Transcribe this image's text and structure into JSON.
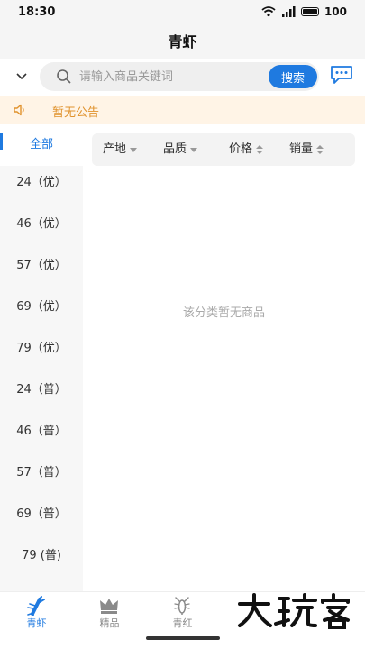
{
  "status": {
    "time": "18:30",
    "battery": "100"
  },
  "header": {
    "title": "青虾"
  },
  "search": {
    "placeholder": "请输入商品关键词",
    "button_label": "搜索"
  },
  "notice": {
    "text": "暂无公告"
  },
  "sidebar": {
    "items": [
      {
        "label": "全部",
        "active": true
      },
      {
        "label": "24（优）"
      },
      {
        "label": "46（优）"
      },
      {
        "label": "57（优）"
      },
      {
        "label": "69（优）"
      },
      {
        "label": "79（优）"
      },
      {
        "label": "24（普）"
      },
      {
        "label": "46（普）"
      },
      {
        "label": "57（普）"
      },
      {
        "label": "69（普）"
      },
      {
        "label": "79 (普)"
      }
    ]
  },
  "sort": {
    "items": [
      "产地",
      "品质",
      "价格",
      "销量"
    ]
  },
  "empty": {
    "text": "该分类暂无商品"
  },
  "tabbar": {
    "items": [
      {
        "label": "青虾",
        "icon": "lobster-icon",
        "active": true
      },
      {
        "label": "精品",
        "icon": "crown-icon"
      },
      {
        "label": "青红",
        "icon": "lobster-outline-icon"
      }
    ]
  },
  "colors": {
    "accent": "#1f7ae0",
    "notice_bg": "#fff4e6",
    "notice_text": "#e0922c"
  }
}
